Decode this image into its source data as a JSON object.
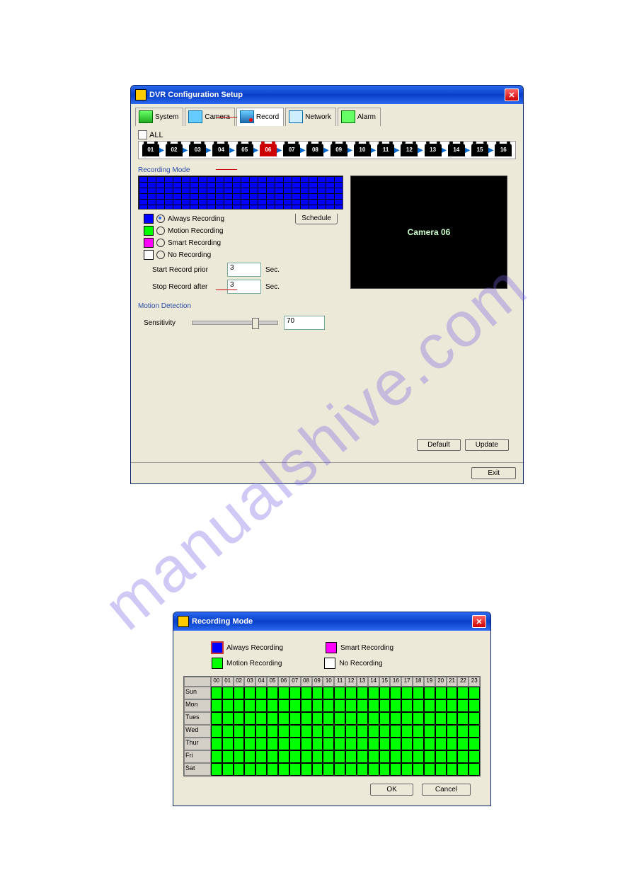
{
  "win1": {
    "title": "DVR Configuration Setup",
    "tabs": {
      "system": "System",
      "camera": "Camera",
      "record": "Record",
      "network": "Network",
      "alarm": "Alarm"
    },
    "all_label": "ALL",
    "cameras": [
      "01",
      "02",
      "03",
      "04",
      "05",
      "06",
      "07",
      "08",
      "09",
      "10",
      "11",
      "12",
      "13",
      "14",
      "15",
      "16"
    ],
    "selected_camera_index": 5,
    "section_recording": "Recording Mode",
    "modes": {
      "always": "Always Recording",
      "motion": "Motion Recording",
      "smart": "Smart Recording",
      "none": "No Recording"
    },
    "schedule_btn": "Schedule",
    "start_prior": "Start Record prior",
    "start_val": "3",
    "sec": "Sec.",
    "stop_after": "Stop Record after",
    "stop_val": "3",
    "preview": "Camera 06",
    "section_motion": "Motion Detection",
    "sensitivity": "Sensitivity",
    "sens_val": "70",
    "default_btn": "Default",
    "update_btn": "Update",
    "exit_btn": "Exit"
  },
  "win2": {
    "title": "Recording Mode",
    "legend": {
      "always": "Always Recording",
      "smart": "Smart Recording",
      "motion": "Motion Recording",
      "none": "No Recording"
    },
    "hours": [
      "00",
      "01",
      "02",
      "03",
      "04",
      "05",
      "06",
      "07",
      "08",
      "09",
      "10",
      "11",
      "12",
      "13",
      "14",
      "15",
      "16",
      "17",
      "18",
      "19",
      "20",
      "21",
      "22",
      "23"
    ],
    "days": [
      "Sun",
      "Mon",
      "Tues",
      "Wed",
      "Thur",
      "Fri",
      "Sat"
    ],
    "ok": "OK",
    "cancel": "Cancel"
  }
}
